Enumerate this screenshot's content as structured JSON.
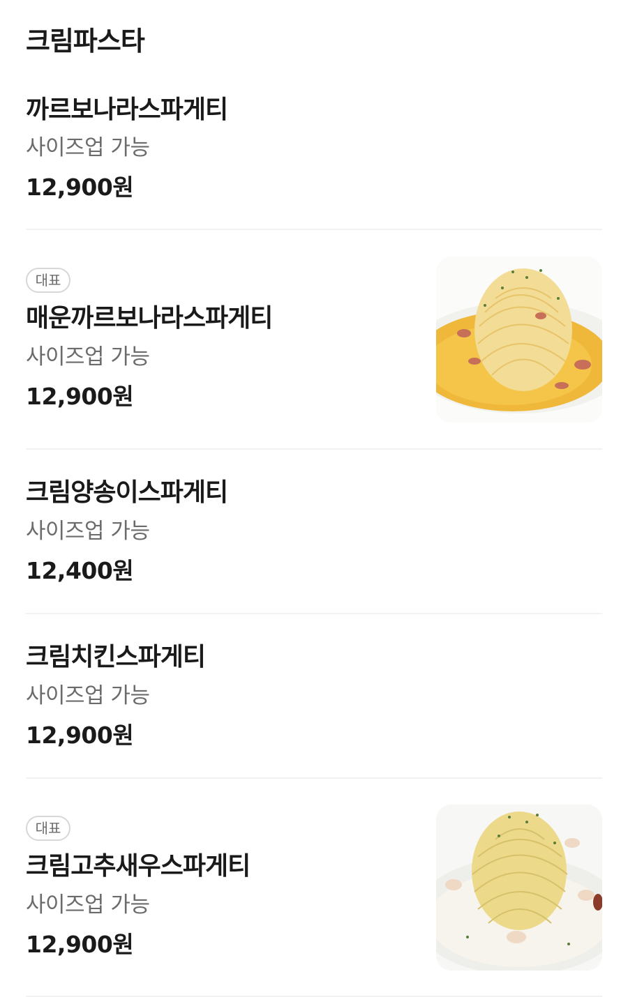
{
  "section": {
    "title": "크림파스타"
  },
  "items": [
    {
      "name": "까르보나라스파게티",
      "description": "사이즈업 가능",
      "price": "12,900원"
    },
    {
      "badge": "대표",
      "name": "매운까르보나라스파게티",
      "description": "사이즈업 가능",
      "price": "12,900원",
      "image_icon": "spicy-carbonara-photo"
    },
    {
      "name": "크림양송이스파게티",
      "description": "사이즈업 가능",
      "price": "12,400원"
    },
    {
      "name": "크림치킨스파게티",
      "description": "사이즈업 가능",
      "price": "12,900원"
    },
    {
      "badge": "대표",
      "name": "크림고추새우스파게티",
      "description": "사이즈업 가능",
      "price": "12,900원",
      "image_icon": "cream-shrimp-pasta-photo"
    }
  ],
  "colors": {
    "text_primary": "#1a1a1a",
    "text_secondary": "#6b6b6b",
    "divider": "#f2f2f2",
    "badge_border": "#d7d7d7"
  }
}
